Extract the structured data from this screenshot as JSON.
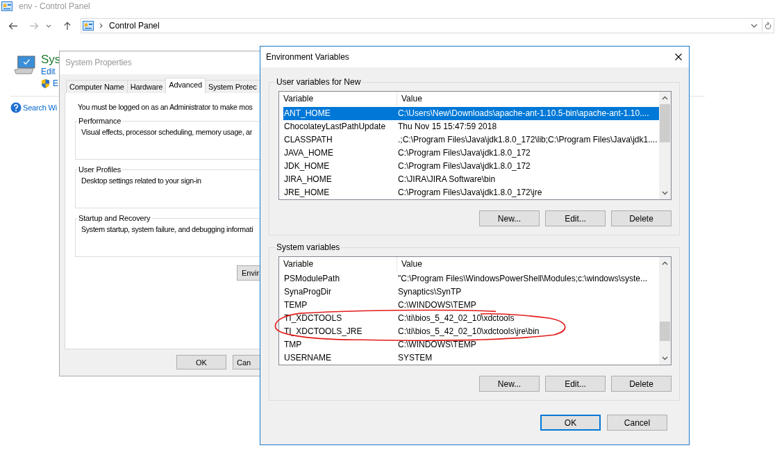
{
  "explorer": {
    "title": "env - Control Panel",
    "address": "Control Panel",
    "heading": "Sys",
    "edit_link": "Edit",
    "shield_link": "E",
    "search_link": "Search Wi"
  },
  "system_properties": {
    "title": "System Properties",
    "tabs": [
      {
        "label": "Computer Name",
        "selected": false
      },
      {
        "label": "Hardware",
        "selected": false
      },
      {
        "label": "Advanced",
        "selected": true
      },
      {
        "label": "System Protec",
        "selected": false
      }
    ],
    "notice": "You must be logged on as an Administrator to make mos",
    "groups": [
      {
        "title": "Performance",
        "text": "Visual effects, processor scheduling, memory usage, ar"
      },
      {
        "title": "User Profiles",
        "text": "Desktop settings related to your sign-in"
      },
      {
        "title": "Startup and Recovery",
        "text": "System startup, system failure, and debugging informati"
      }
    ],
    "env_button": "Envir",
    "buttons": [
      "OK",
      "Can"
    ]
  },
  "environment_variables": {
    "title": "Environment Variables",
    "lists": [
      {
        "title": "User variables for New",
        "columns": [
          "Variable",
          "Value"
        ],
        "rows": [
          {
            "variable": "ANT_HOME",
            "value": "C:\\Users\\New\\Downloads\\apache-ant-1.10.5-bin\\apache-ant-1.10....",
            "selected": true,
            "circled": false
          },
          {
            "variable": "ChocolateyLastPathUpdate",
            "value": "Thu Nov 15 15:47:59 2018",
            "selected": false,
            "circled": false
          },
          {
            "variable": "CLASSPATH",
            "value": ".;C:\\Program Files\\Java\\jdk1.8.0_172\\lib;C:\\Program Files\\Java\\jdk1....",
            "selected": false,
            "circled": false
          },
          {
            "variable": "JAVA_HOME",
            "value": "C:\\Program Files\\Java\\jdk1.8.0_172",
            "selected": false,
            "circled": false
          },
          {
            "variable": "JDK_HOME",
            "value": "C:\\Program Files\\Java\\jdk1.8.0_172",
            "selected": false,
            "circled": false
          },
          {
            "variable": "JIRA_HOME",
            "value": "C:\\JIRA\\JIRA Software\\bin",
            "selected": false,
            "circled": false
          },
          {
            "variable": "JRE_HOME",
            "value": "C:\\Program Files\\Java\\jdk1.8.0_172\\jre",
            "selected": false,
            "circled": false
          }
        ],
        "buttons": [
          "New...",
          "Edit...",
          "Delete"
        ]
      },
      {
        "title": "System variables",
        "columns": [
          "Variable",
          "Value"
        ],
        "rows": [
          {
            "variable": "PSModulePath",
            "value": "\"C:\\Program Files\\WindowsPowerShell\\Modules;c:\\windows\\syste...",
            "selected": false,
            "circled": false
          },
          {
            "variable": "SynaProgDir",
            "value": "Synaptics\\SynTP",
            "selected": false,
            "circled": false
          },
          {
            "variable": "TEMP",
            "value": "C:\\WINDOWS\\TEMP",
            "selected": false,
            "circled": false
          },
          {
            "variable": "TI_XDCTOOLS",
            "value": "C:\\ti\\bios_5_42_02_10\\xdctools",
            "selected": false,
            "circled": true
          },
          {
            "variable": "TI_XDCTOOLS_JRE",
            "value": "C:\\ti\\bios_5_42_02_10\\xdctools\\jre\\bin",
            "selected": false,
            "circled": true
          },
          {
            "variable": "TMP",
            "value": "C:\\WINDOWS\\TEMP",
            "selected": false,
            "circled": false
          },
          {
            "variable": "USERNAME",
            "value": "SYSTEM",
            "selected": false,
            "circled": false
          }
        ],
        "buttons": [
          "New...",
          "Edit...",
          "Delete"
        ]
      }
    ],
    "buttons": [
      {
        "label": "OK",
        "default": true
      },
      {
        "label": "Cancel",
        "default": false
      }
    ]
  }
}
